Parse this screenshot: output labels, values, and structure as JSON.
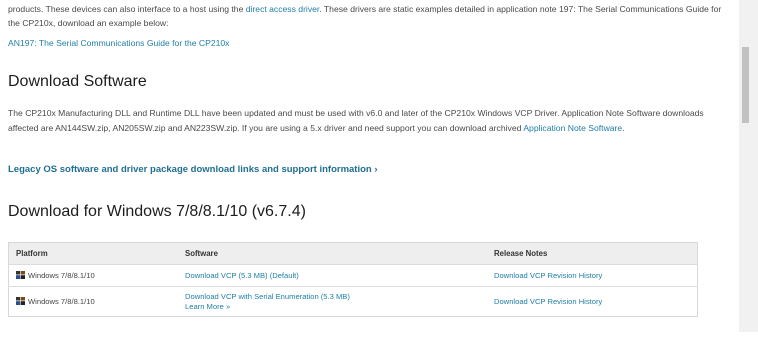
{
  "intro": {
    "text_before_link": "products. These devices can also interface to a host using the ",
    "link": "direct access driver",
    "text_after_link": ". These drivers are static examples detailed in application note 197: The Serial Communications Guide for the CP210x, download an example below:"
  },
  "reference_link": "AN197: The Serial Communications Guide for the CP210x",
  "download_software": {
    "heading": "Download Software",
    "paragraph": "The CP210x Manufacturing DLL and Runtime DLL have been updated and must be used with v6.0 and later of the CP210x Windows VCP Driver. Application Note Software downloads affected are AN144SW.zip, AN205SW.zip and AN223SW.zip. If you are using a 5.x driver and need support you can download archived ",
    "archive_link": "Application Note Software",
    "paragraph_end": "."
  },
  "legacy_link": "Legacy OS software and driver package download links and support information ›",
  "windows_section": {
    "heading": "Download for Windows 7/8/8.1/10 (v6.7.4)",
    "columns": [
      "Platform",
      "Software",
      "Release Notes"
    ],
    "rows": [
      {
        "platform": "Windows 7/8/8.1/10",
        "software": "Download VCP (5.3 MB) (Default)",
        "notes": "Download VCP Revision History"
      },
      {
        "platform": "Windows 7/8/8.1/10",
        "software": "Download VCP with Serial Enumeration (5.3 MB)",
        "software_sub": "Learn More »",
        "notes": "Download VCP Revision History"
      }
    ]
  },
  "colors": {
    "link": "#1f7fa6",
    "legacy_link": "#1f6f94",
    "table_header_bg": "#eeeeee"
  },
  "icons": {
    "platform": "windows-icon"
  }
}
